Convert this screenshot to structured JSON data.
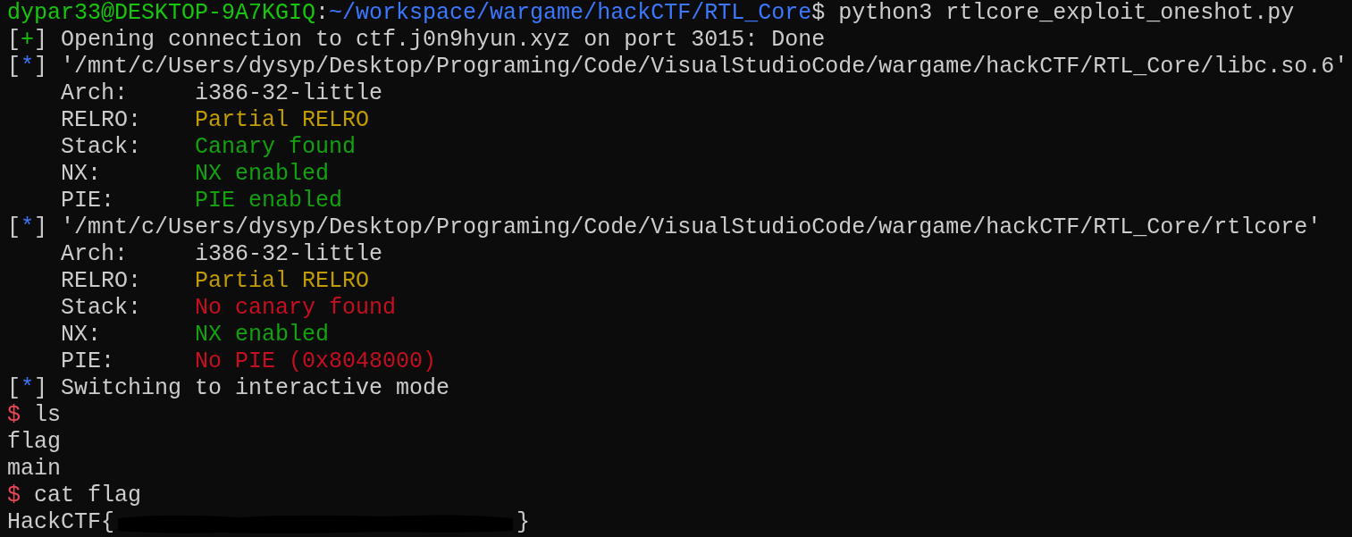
{
  "terminal": {
    "lines": [
      {
        "segments": [
          {
            "kind": "text",
            "text": "dypar33@DESKTOP-9A7KGIQ",
            "color": "#16c60c"
          },
          {
            "kind": "text",
            "text": ":",
            "color": "#cccccc"
          },
          {
            "kind": "text",
            "text": "~/workspace/wargame/hackCTF/RTL_Core",
            "color": "#3b78ff"
          },
          {
            "kind": "text",
            "text": "$ python3 rtlcore_exploit_oneshot.py",
            "color": "#cccccc"
          }
        ]
      },
      {
        "segments": [
          {
            "kind": "text",
            "text": "[",
            "color": "#cccccc"
          },
          {
            "kind": "text",
            "text": "+",
            "color": "#16c60c"
          },
          {
            "kind": "text",
            "text": "] Opening connection to ctf.j0n9hyun.xyz on port 3015: Done",
            "color": "#cccccc"
          }
        ]
      },
      {
        "segments": [
          {
            "kind": "text",
            "text": "[",
            "color": "#cccccc"
          },
          {
            "kind": "text",
            "text": "*",
            "color": "#3b78ff"
          },
          {
            "kind": "text",
            "text": "] '/mnt/c/Users/dysyp/Desktop/Programing/Code/VisualStudioCode/wargame/hackCTF/RTL_Core/libc.so.6'",
            "color": "#cccccc"
          }
        ]
      },
      {
        "segments": [
          {
            "kind": "text",
            "text": "    Arch:     i386-32-little",
            "color": "#cccccc"
          }
        ]
      },
      {
        "segments": [
          {
            "kind": "text",
            "text": "    RELRO:    ",
            "color": "#cccccc"
          },
          {
            "kind": "text",
            "text": "Partial RELRO",
            "color": "#c19c00"
          }
        ]
      },
      {
        "segments": [
          {
            "kind": "text",
            "text": "    Stack:    ",
            "color": "#cccccc"
          },
          {
            "kind": "text",
            "text": "Canary found",
            "color": "#13a10e"
          }
        ]
      },
      {
        "segments": [
          {
            "kind": "text",
            "text": "    NX:       ",
            "color": "#cccccc"
          },
          {
            "kind": "text",
            "text": "NX enabled",
            "color": "#13a10e"
          }
        ]
      },
      {
        "segments": [
          {
            "kind": "text",
            "text": "    PIE:      ",
            "color": "#cccccc"
          },
          {
            "kind": "text",
            "text": "PIE enabled",
            "color": "#13a10e"
          }
        ]
      },
      {
        "segments": [
          {
            "kind": "text",
            "text": "[",
            "color": "#cccccc"
          },
          {
            "kind": "text",
            "text": "*",
            "color": "#3b78ff"
          },
          {
            "kind": "text",
            "text": "] '/mnt/c/Users/dysyp/Desktop/Programing/Code/VisualStudioCode/wargame/hackCTF/RTL_Core/rtlcore'",
            "color": "#cccccc"
          }
        ]
      },
      {
        "segments": [
          {
            "kind": "text",
            "text": "    Arch:     i386-32-little",
            "color": "#cccccc"
          }
        ]
      },
      {
        "segments": [
          {
            "kind": "text",
            "text": "    RELRO:    ",
            "color": "#cccccc"
          },
          {
            "kind": "text",
            "text": "Partial RELRO",
            "color": "#c19c00"
          }
        ]
      },
      {
        "segments": [
          {
            "kind": "text",
            "text": "    Stack:    ",
            "color": "#cccccc"
          },
          {
            "kind": "text",
            "text": "No canary found",
            "color": "#c50f1f"
          }
        ]
      },
      {
        "segments": [
          {
            "kind": "text",
            "text": "    NX:       ",
            "color": "#cccccc"
          },
          {
            "kind": "text",
            "text": "NX enabled",
            "color": "#13a10e"
          }
        ]
      },
      {
        "segments": [
          {
            "kind": "text",
            "text": "    PIE:      ",
            "color": "#cccccc"
          },
          {
            "kind": "text",
            "text": "No PIE (0x8048000)",
            "color": "#c50f1f"
          }
        ]
      },
      {
        "segments": [
          {
            "kind": "text",
            "text": "[",
            "color": "#cccccc"
          },
          {
            "kind": "text",
            "text": "*",
            "color": "#3b78ff"
          },
          {
            "kind": "text",
            "text": "] Switching to interactive mode",
            "color": "#cccccc"
          }
        ]
      },
      {
        "segments": [
          {
            "kind": "text",
            "text": "$",
            "color": "#e74856"
          },
          {
            "kind": "text",
            "text": " ls",
            "color": "#cccccc"
          }
        ]
      },
      {
        "segments": [
          {
            "kind": "text",
            "text": "flag",
            "color": "#cccccc"
          }
        ]
      },
      {
        "segments": [
          {
            "kind": "text",
            "text": "main",
            "color": "#cccccc"
          }
        ]
      },
      {
        "segments": [
          {
            "kind": "text",
            "text": "$",
            "color": "#e74856"
          },
          {
            "kind": "text",
            "text": " cat flag",
            "color": "#cccccc"
          }
        ]
      },
      {
        "segments": [
          {
            "kind": "text",
            "text": "HackCTF{",
            "color": "#cccccc"
          },
          {
            "kind": "redaction"
          },
          {
            "kind": "text",
            "text": "}",
            "color": "#cccccc"
          }
        ]
      }
    ]
  }
}
